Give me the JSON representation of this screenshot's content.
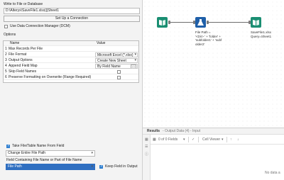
{
  "left": {
    "title": "Write to File or Database",
    "file_path": "D:\\Alteryx\\SaveFile1.xlsx|||Sheet1",
    "connection_button": "Set Up a Connection",
    "use_dcm_label": "Use Data Connection Manager (DCM)",
    "options_label": "Options",
    "table_headers": {
      "name": "Name",
      "value": "Value"
    },
    "rows": [
      {
        "num": "1",
        "name": "Max Records Per File",
        "value": ""
      },
      {
        "num": "2",
        "name": "File Format",
        "value": "Microsoft Excel (*.xlsx)"
      },
      {
        "num": "3",
        "name": "Output Options",
        "value": "Create New Sheet"
      },
      {
        "num": "4",
        "name": "Append Field Map",
        "value": "By Field Name",
        "ellipsis": "..."
      },
      {
        "num": "5",
        "name": "Skip Field Names",
        "value": ""
      },
      {
        "num": "6",
        "name": "Preserve Formatting on Overwrite (Range Required)",
        "value": ""
      }
    ],
    "take_name_label": "Take File/Table Name From Field",
    "change_mode": "Change Entire File Path",
    "field_containing_label": "Field Containing File Name or Part of File Name",
    "field_select": "File Path",
    "keep_field_label": "Keep Field in Output"
  },
  "canvas": {
    "formula_note": "File Path =\n'<Dir> ' + 'folder' +\n'subfolder1' + 'subf\nolder2'",
    "output_note": "SaveFile1.xlsx\nQuery=Sheet1"
  },
  "results": {
    "header_title": "Results",
    "header_subtitle": "- Output Data (4) - Input",
    "fields_label": "0 of 0 Fields",
    "cell_viewer_label": "Cell Viewer",
    "no_data": "No data a"
  },
  "colors": {
    "input_tool": "#1a8e72",
    "formula_tool": "#1f5fa8",
    "output_tool": "#1a8e72",
    "checkbox_on": "#2f7fd0"
  }
}
